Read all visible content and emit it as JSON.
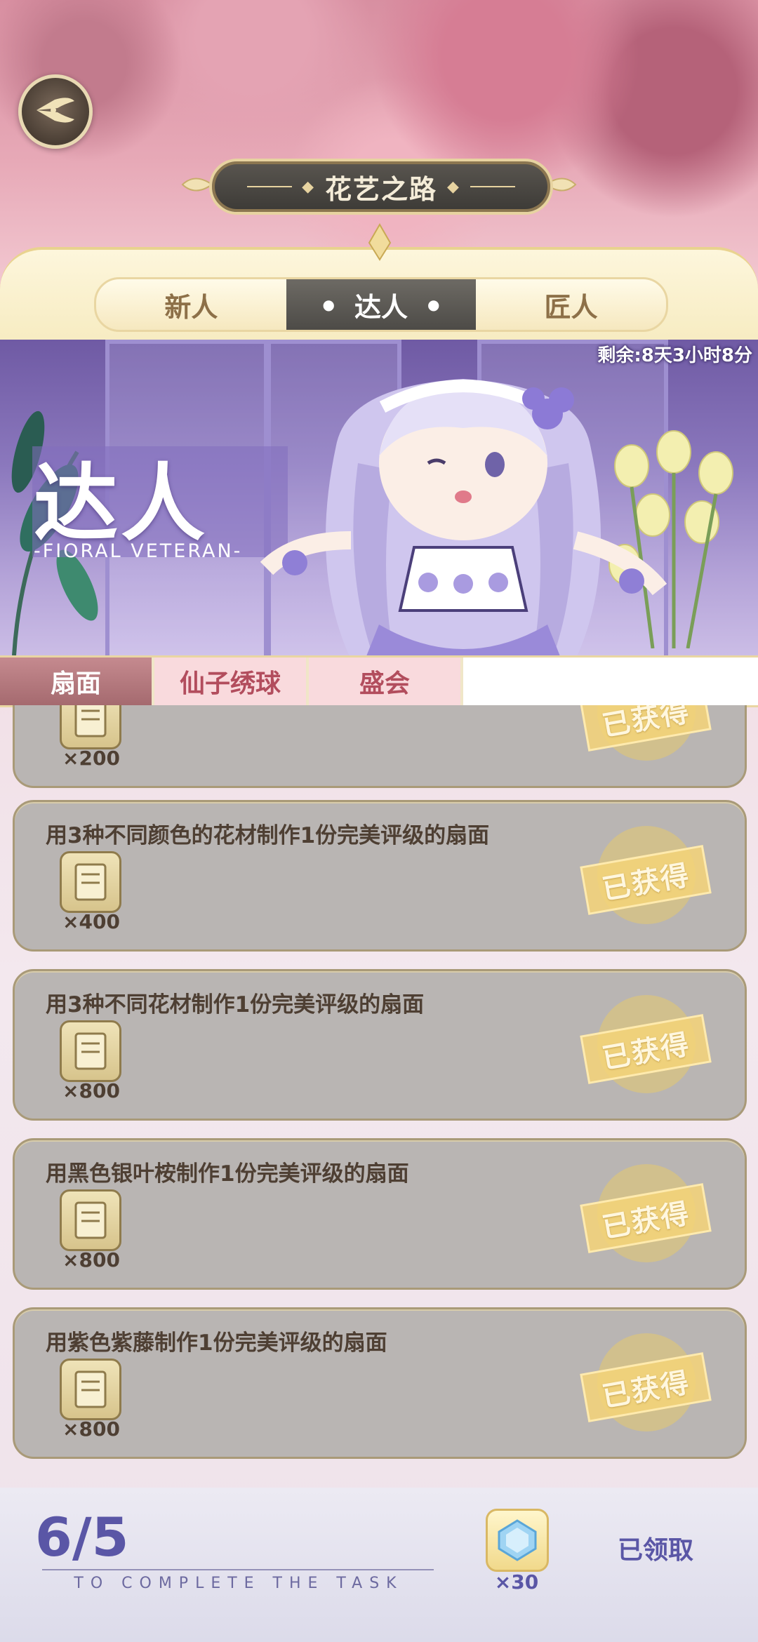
{
  "header": {
    "title": "花艺之路",
    "back_icon": "wing-back-icon"
  },
  "tabs": [
    {
      "label": "新人",
      "active": false
    },
    {
      "label": "达人",
      "active": true
    },
    {
      "label": "匠人",
      "active": false
    }
  ],
  "banner": {
    "timer": "剩余:8天3小时8分",
    "rank_title": "达人",
    "rank_subtitle": "-FIORAL VETERAN-"
  },
  "subtabs": [
    {
      "label": "扇面",
      "active": true
    },
    {
      "label": "仙子绣球",
      "active": false
    },
    {
      "label": "盛会",
      "active": false
    }
  ],
  "tasks": [
    {
      "description": "",
      "reward_qty": "×200",
      "status": "已获得",
      "partial": true
    },
    {
      "description": "用3种不同颜色的花材制作1份完美评级的扇面",
      "reward_qty": "×400",
      "status": "已获得"
    },
    {
      "description": "用3种不同花材制作1份完美评级的扇面",
      "reward_qty": "×800",
      "status": "已获得"
    },
    {
      "description": "用黑色银叶桉制作1份完美评级的扇面",
      "reward_qty": "×800",
      "status": "已获得"
    },
    {
      "description": "用紫色紫藤制作1份完美评级的扇面",
      "reward_qty": "×800",
      "status": "已获得"
    }
  ],
  "footer": {
    "progress": "6/5",
    "caption": "TO COMPLETE THE TASK",
    "reward_qty": "×30",
    "reward_icon": "crystal-gem-icon",
    "claim_label": "已领取"
  },
  "colors": {
    "accent_purple": "#5a56a6",
    "tab_active": "#4d4b47",
    "subtab_active": "#a56a6f",
    "gold": "#e7d3a0"
  }
}
